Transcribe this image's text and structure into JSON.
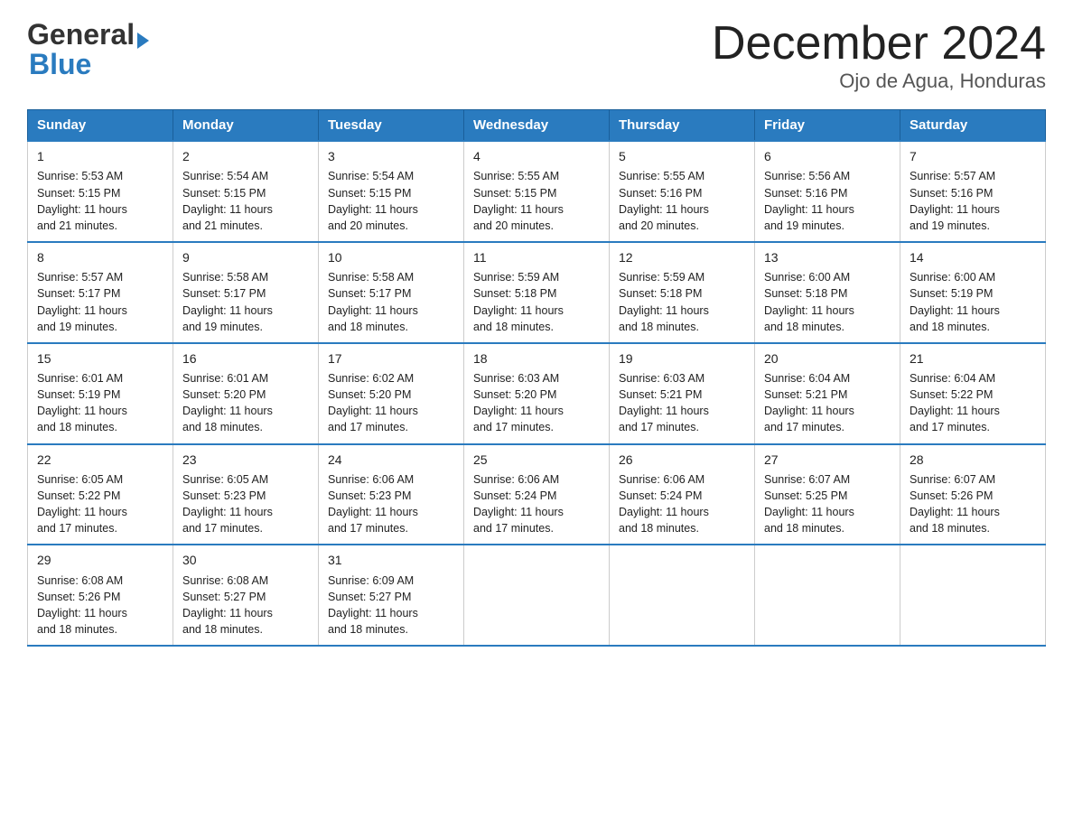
{
  "logo": {
    "general": "General",
    "triangle": "▶",
    "blue": "Blue"
  },
  "title": "December 2024",
  "subtitle": "Ojo de Agua, Honduras",
  "days_of_week": [
    "Sunday",
    "Monday",
    "Tuesday",
    "Wednesday",
    "Thursday",
    "Friday",
    "Saturday"
  ],
  "weeks": [
    [
      {
        "day": "1",
        "line1": "Sunrise: 5:53 AM",
        "line2": "Sunset: 5:15 PM",
        "line3": "Daylight: 11 hours",
        "line4": "and 21 minutes."
      },
      {
        "day": "2",
        "line1": "Sunrise: 5:54 AM",
        "line2": "Sunset: 5:15 PM",
        "line3": "Daylight: 11 hours",
        "line4": "and 21 minutes."
      },
      {
        "day": "3",
        "line1": "Sunrise: 5:54 AM",
        "line2": "Sunset: 5:15 PM",
        "line3": "Daylight: 11 hours",
        "line4": "and 20 minutes."
      },
      {
        "day": "4",
        "line1": "Sunrise: 5:55 AM",
        "line2": "Sunset: 5:15 PM",
        "line3": "Daylight: 11 hours",
        "line4": "and 20 minutes."
      },
      {
        "day": "5",
        "line1": "Sunrise: 5:55 AM",
        "line2": "Sunset: 5:16 PM",
        "line3": "Daylight: 11 hours",
        "line4": "and 20 minutes."
      },
      {
        "day": "6",
        "line1": "Sunrise: 5:56 AM",
        "line2": "Sunset: 5:16 PM",
        "line3": "Daylight: 11 hours",
        "line4": "and 19 minutes."
      },
      {
        "day": "7",
        "line1": "Sunrise: 5:57 AM",
        "line2": "Sunset: 5:16 PM",
        "line3": "Daylight: 11 hours",
        "line4": "and 19 minutes."
      }
    ],
    [
      {
        "day": "8",
        "line1": "Sunrise: 5:57 AM",
        "line2": "Sunset: 5:17 PM",
        "line3": "Daylight: 11 hours",
        "line4": "and 19 minutes."
      },
      {
        "day": "9",
        "line1": "Sunrise: 5:58 AM",
        "line2": "Sunset: 5:17 PM",
        "line3": "Daylight: 11 hours",
        "line4": "and 19 minutes."
      },
      {
        "day": "10",
        "line1": "Sunrise: 5:58 AM",
        "line2": "Sunset: 5:17 PM",
        "line3": "Daylight: 11 hours",
        "line4": "and 18 minutes."
      },
      {
        "day": "11",
        "line1": "Sunrise: 5:59 AM",
        "line2": "Sunset: 5:18 PM",
        "line3": "Daylight: 11 hours",
        "line4": "and 18 minutes."
      },
      {
        "day": "12",
        "line1": "Sunrise: 5:59 AM",
        "line2": "Sunset: 5:18 PM",
        "line3": "Daylight: 11 hours",
        "line4": "and 18 minutes."
      },
      {
        "day": "13",
        "line1": "Sunrise: 6:00 AM",
        "line2": "Sunset: 5:18 PM",
        "line3": "Daylight: 11 hours",
        "line4": "and 18 minutes."
      },
      {
        "day": "14",
        "line1": "Sunrise: 6:00 AM",
        "line2": "Sunset: 5:19 PM",
        "line3": "Daylight: 11 hours",
        "line4": "and 18 minutes."
      }
    ],
    [
      {
        "day": "15",
        "line1": "Sunrise: 6:01 AM",
        "line2": "Sunset: 5:19 PM",
        "line3": "Daylight: 11 hours",
        "line4": "and 18 minutes."
      },
      {
        "day": "16",
        "line1": "Sunrise: 6:01 AM",
        "line2": "Sunset: 5:20 PM",
        "line3": "Daylight: 11 hours",
        "line4": "and 18 minutes."
      },
      {
        "day": "17",
        "line1": "Sunrise: 6:02 AM",
        "line2": "Sunset: 5:20 PM",
        "line3": "Daylight: 11 hours",
        "line4": "and 17 minutes."
      },
      {
        "day": "18",
        "line1": "Sunrise: 6:03 AM",
        "line2": "Sunset: 5:20 PM",
        "line3": "Daylight: 11 hours",
        "line4": "and 17 minutes."
      },
      {
        "day": "19",
        "line1": "Sunrise: 6:03 AM",
        "line2": "Sunset: 5:21 PM",
        "line3": "Daylight: 11 hours",
        "line4": "and 17 minutes."
      },
      {
        "day": "20",
        "line1": "Sunrise: 6:04 AM",
        "line2": "Sunset: 5:21 PM",
        "line3": "Daylight: 11 hours",
        "line4": "and 17 minutes."
      },
      {
        "day": "21",
        "line1": "Sunrise: 6:04 AM",
        "line2": "Sunset: 5:22 PM",
        "line3": "Daylight: 11 hours",
        "line4": "and 17 minutes."
      }
    ],
    [
      {
        "day": "22",
        "line1": "Sunrise: 6:05 AM",
        "line2": "Sunset: 5:22 PM",
        "line3": "Daylight: 11 hours",
        "line4": "and 17 minutes."
      },
      {
        "day": "23",
        "line1": "Sunrise: 6:05 AM",
        "line2": "Sunset: 5:23 PM",
        "line3": "Daylight: 11 hours",
        "line4": "and 17 minutes."
      },
      {
        "day": "24",
        "line1": "Sunrise: 6:06 AM",
        "line2": "Sunset: 5:23 PM",
        "line3": "Daylight: 11 hours",
        "line4": "and 17 minutes."
      },
      {
        "day": "25",
        "line1": "Sunrise: 6:06 AM",
        "line2": "Sunset: 5:24 PM",
        "line3": "Daylight: 11 hours",
        "line4": "and 17 minutes."
      },
      {
        "day": "26",
        "line1": "Sunrise: 6:06 AM",
        "line2": "Sunset: 5:24 PM",
        "line3": "Daylight: 11 hours",
        "line4": "and 18 minutes."
      },
      {
        "day": "27",
        "line1": "Sunrise: 6:07 AM",
        "line2": "Sunset: 5:25 PM",
        "line3": "Daylight: 11 hours",
        "line4": "and 18 minutes."
      },
      {
        "day": "28",
        "line1": "Sunrise: 6:07 AM",
        "line2": "Sunset: 5:26 PM",
        "line3": "Daylight: 11 hours",
        "line4": "and 18 minutes."
      }
    ],
    [
      {
        "day": "29",
        "line1": "Sunrise: 6:08 AM",
        "line2": "Sunset: 5:26 PM",
        "line3": "Daylight: 11 hours",
        "line4": "and 18 minutes."
      },
      {
        "day": "30",
        "line1": "Sunrise: 6:08 AM",
        "line2": "Sunset: 5:27 PM",
        "line3": "Daylight: 11 hours",
        "line4": "and 18 minutes."
      },
      {
        "day": "31",
        "line1": "Sunrise: 6:09 AM",
        "line2": "Sunset: 5:27 PM",
        "line3": "Daylight: 11 hours",
        "line4": "and 18 minutes."
      },
      null,
      null,
      null,
      null
    ]
  ]
}
